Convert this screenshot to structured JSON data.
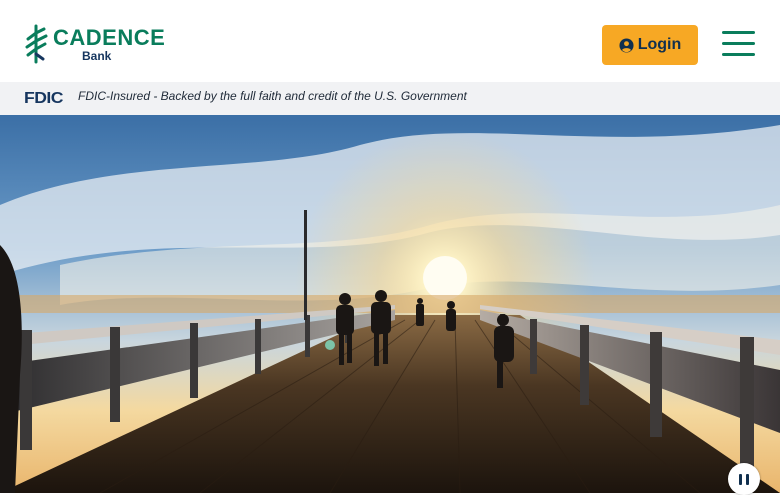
{
  "brand": {
    "name": "CADENCE",
    "sub": "Bank",
    "color": "#0a7d5c"
  },
  "header": {
    "login_label": "Login",
    "login_icon": "user-circle-icon",
    "menu_icon": "hamburger-menu-icon"
  },
  "fdic": {
    "logo_text": "FDIC",
    "statement": "FDIC-Insured - Backed by the full faith and credit of the U.S. Government"
  },
  "hero": {
    "media": "sunset pier photo",
    "control_icon": "pause-icon"
  },
  "colors": {
    "accent": "#f7a824",
    "navy": "#16365f",
    "brand_green": "#0a7d5c"
  }
}
